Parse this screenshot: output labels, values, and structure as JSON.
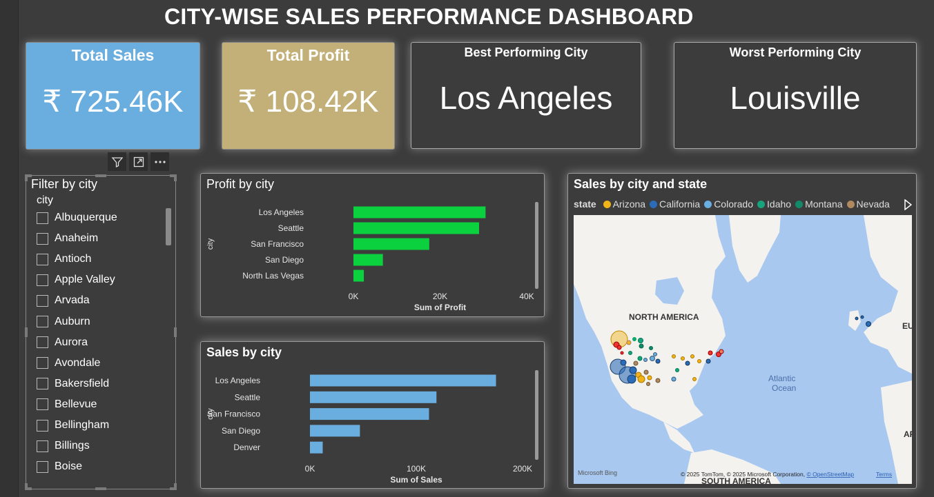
{
  "page": {
    "title": "CITY-WISE SALES PERFORMANCE DASHBOARD"
  },
  "kpis": {
    "total_sales": {
      "label": "Total Sales",
      "value": "₹ 725.46K",
      "color": "#6aaee0"
    },
    "total_profit": {
      "label": "Total Profit",
      "value": "₹ 108.42K",
      "color": "#c3b078"
    },
    "best_city": {
      "label": "Best Performing City",
      "value": "Los Angeles"
    },
    "worst_city": {
      "label": "Worst Performing City",
      "value": "Louisville"
    }
  },
  "toolbar": {
    "icons": [
      "filter-icon",
      "focus-mode-icon",
      "more-options-icon"
    ]
  },
  "slicer": {
    "title": "Filter by city",
    "field": "city",
    "items": [
      "Albuquerque",
      "Anaheim",
      "Antioch",
      "Apple Valley",
      "Arvada",
      "Auburn",
      "Aurora",
      "Avondale",
      "Bakersfield",
      "Bellevue",
      "Bellingham",
      "Billings",
      "Boise"
    ]
  },
  "profit_chart": {
    "title": "Profit by city",
    "chart_data": {
      "type": "bar",
      "categories": [
        "Los Angeles",
        "Seattle",
        "San Francisco",
        "San Diego",
        "North Las Vegas"
      ],
      "values": [
        30500,
        29000,
        17500,
        6800,
        2400
      ],
      "xlabel": "Sum of Profit",
      "ylabel": "city",
      "xlim": [
        0,
        40000
      ],
      "ticks": [
        "0K",
        "20K",
        "40K"
      ],
      "color": "#0bd13f"
    }
  },
  "sales_chart": {
    "title": "Sales by city",
    "chart_data": {
      "type": "bar",
      "categories": [
        "Los Angeles",
        "Seattle",
        "San Francisco",
        "San Diego",
        "Denver"
      ],
      "values": [
        175000,
        119000,
        112000,
        47000,
        12000
      ],
      "xlabel": "Sum of Sales",
      "ylabel": "city",
      "xlim": [
        0,
        200000
      ],
      "ticks": [
        "0K",
        "100K",
        "200K"
      ],
      "color": "#6aaee0"
    }
  },
  "map": {
    "title": "Sales by city and state",
    "legend_title": "state",
    "legend": [
      {
        "name": "Arizona",
        "color": "#f0b419"
      },
      {
        "name": "California",
        "color": "#2b6cb8"
      },
      {
        "name": "Colorado",
        "color": "#6aaee0"
      },
      {
        "name": "Idaho",
        "color": "#17a47c"
      },
      {
        "name": "Montana",
        "color": "#128a6a"
      },
      {
        "name": "Nevada",
        "color": "#b08a5e"
      }
    ],
    "labels": {
      "continent_na": "NORTH AMERICA",
      "ocean": "Atlantic\nOcean",
      "continent_sa": "SOUTH AMERICA",
      "eu": "EU",
      "af": "AF"
    },
    "attribution": "© 2025 TomTom, © 2025 Microsoft Corporation, © OpenStreetMap",
    "terms": "Terms",
    "bing": "Microsoft Bing"
  }
}
